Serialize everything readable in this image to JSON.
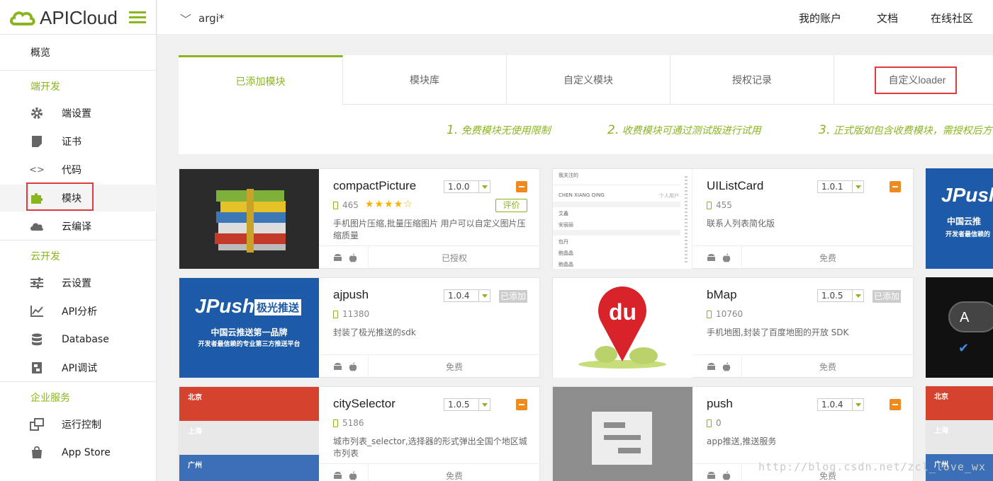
{
  "app": {
    "logo_text": "APICloud",
    "brand_color": "#8ab51f"
  },
  "sidebar": {
    "overview": "概览",
    "section_device": "端开发",
    "device_items": [
      {
        "label": "端设置",
        "icon": "gear-icon"
      },
      {
        "label": "证书",
        "icon": "certificate-icon"
      },
      {
        "label": "代码",
        "icon": "code-icon"
      },
      {
        "label": "模块",
        "icon": "puzzle-icon"
      },
      {
        "label": "云编译",
        "icon": "cloud-icon"
      }
    ],
    "section_cloud": "云开发",
    "cloud_items": [
      {
        "label": "云设置",
        "icon": "sliders-icon"
      },
      {
        "label": "API分析",
        "icon": "chart-icon"
      },
      {
        "label": "Database",
        "icon": "database-icon"
      },
      {
        "label": "API调试",
        "icon": "debug-icon"
      }
    ],
    "section_enterprise": "企业服务",
    "enterprise_items": [
      {
        "label": "运行控制",
        "icon": "windows-icon"
      },
      {
        "label": "App Store",
        "icon": "bag-icon"
      }
    ]
  },
  "header": {
    "project_name": "argi*",
    "links": [
      "我的账户",
      "文档",
      "在线社区"
    ]
  },
  "tabs": [
    "已添加模块",
    "模块库",
    "自定义模块",
    "授权记录",
    "自定义loader"
  ],
  "tips": [
    {
      "num": "1.",
      "text": "免费模块无使用限制"
    },
    {
      "num": "2.",
      "text": "收费模块可通过测试版进行试用"
    },
    {
      "num": "3.",
      "text": "正式版如包含收费模块，需授权后方"
    }
  ],
  "modules": [
    {
      "name": "compactPicture",
      "version": "1.0.0",
      "downloads": "465",
      "stars": "★★★★☆",
      "rate_label": "评价",
      "desc": "手机图片压缩,批量压缩图片 用户可以自定义图片压缩质量",
      "status": "已授权",
      "action": "minus"
    },
    {
      "name": "UIListCard",
      "version": "1.0.1",
      "downloads": "455",
      "desc": "联系人列表简化版",
      "status": "免费",
      "action": "minus"
    },
    {
      "name": "ajpush",
      "version": "1.0.4",
      "downloads": "11380",
      "desc": "封装了极光推送的sdk",
      "status": "免费",
      "action": "added",
      "added_label": "已添加"
    },
    {
      "name": "bMap",
      "version": "1.0.5",
      "downloads": "10760",
      "desc": "手机地图,封装了百度地图的开放 SDK",
      "status": "免费",
      "action": "added",
      "added_label": "已添加"
    },
    {
      "name": "citySelector",
      "version": "1.0.5",
      "downloads": "5186",
      "desc": "城市列表_selector,选择器的形式弹出全国个地区城市列表",
      "status": "免费",
      "action": "minus"
    },
    {
      "name": "push",
      "version": "1.0.4",
      "downloads": "0",
      "desc": "app推送,推送服务",
      "status": "免费",
      "action": "minus"
    }
  ],
  "thumbs": {
    "jpush_logo": "JPush",
    "jpush_tag": "极光推送",
    "jpush_line1": "中国云推送第一品牌",
    "jpush_line2": "开发者最信赖的专业第三方推送平台",
    "jpush_edge_line1": "中国云推",
    "jpush_edge_line2": "开发者最信赖的",
    "du": "du",
    "city1": "北京",
    "city2": "上海",
    "city3": "广州",
    "list_rows": [
      "我关注的",
      "CHEN XIANG QING",
      "艾鑫",
      "安丽丽",
      "包丹",
      "鲍晶晶",
      "鲍晶晶"
    ],
    "list_tag": "个人用户",
    "key_a": "A"
  },
  "watermark": "http://blog.csdn.net/zcl_love_wx"
}
